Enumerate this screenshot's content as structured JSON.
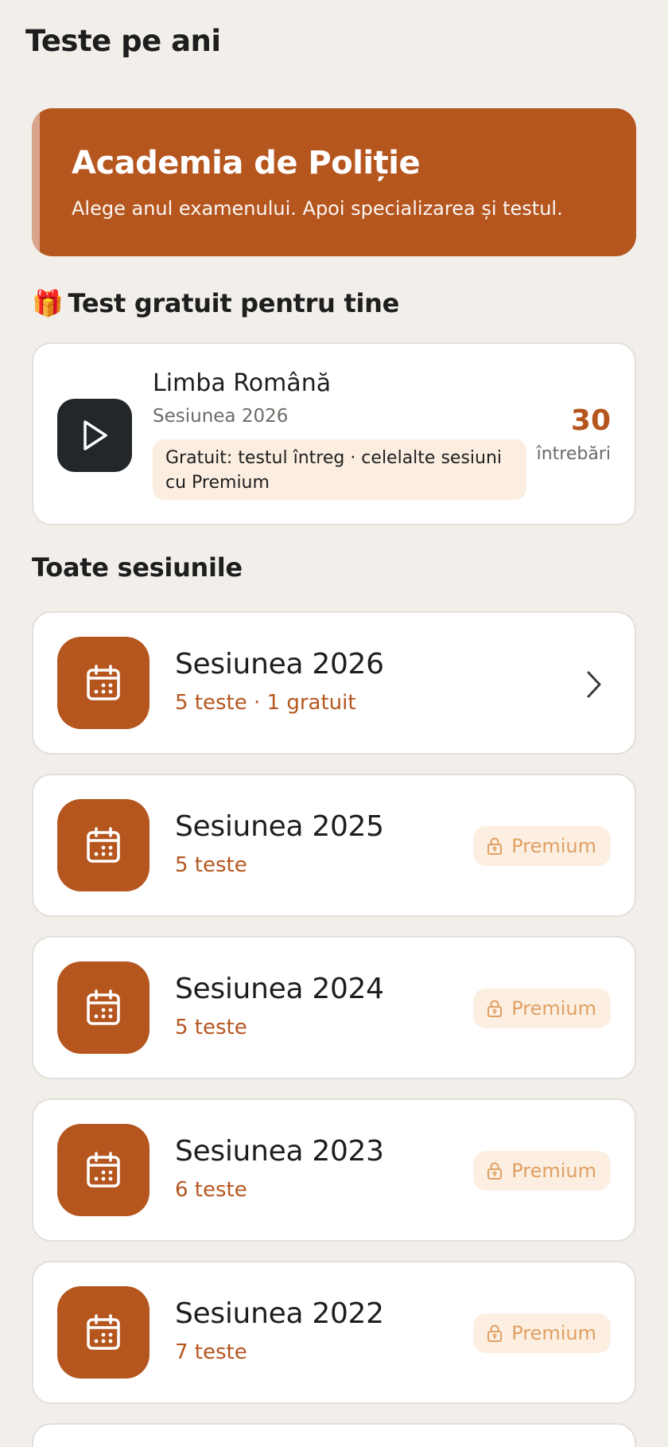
{
  "header": {
    "title": "Teste pe ani"
  },
  "hero": {
    "title": "Academia de Poliție",
    "subtitle": "Alege anul examenului. Apoi specializarea și testul."
  },
  "free_section": {
    "emoji": "🎁",
    "title": "Test gratuit pentru tine",
    "card": {
      "subject": "Limba Română",
      "session": "Sesiunea 2026",
      "note": "Gratuit: testul întreg · celelalte sesiuni cu Premium",
      "count": "30",
      "count_label": "întrebări"
    }
  },
  "sessions_section": {
    "title": "Toate sesiunile",
    "items": [
      {
        "title": "Sesiunea 2026",
        "meta": "5 teste · 1 gratuit",
        "badge": ""
      },
      {
        "title": "Sesiunea 2025",
        "meta": "5 teste",
        "badge": "Premium"
      },
      {
        "title": "Sesiunea 2024",
        "meta": "5 teste",
        "badge": "Premium"
      },
      {
        "title": "Sesiunea 2023",
        "meta": "6 teste",
        "badge": "Premium"
      },
      {
        "title": "Sesiunea 2022",
        "meta": "7 teste",
        "badge": "Premium"
      }
    ]
  },
  "colors": {
    "accent": "#B5561F",
    "background": "#F2EFEA",
    "premium_text": "#E0A064",
    "premium_bg": "#FCEFE1",
    "play_bg": "#23272A"
  }
}
